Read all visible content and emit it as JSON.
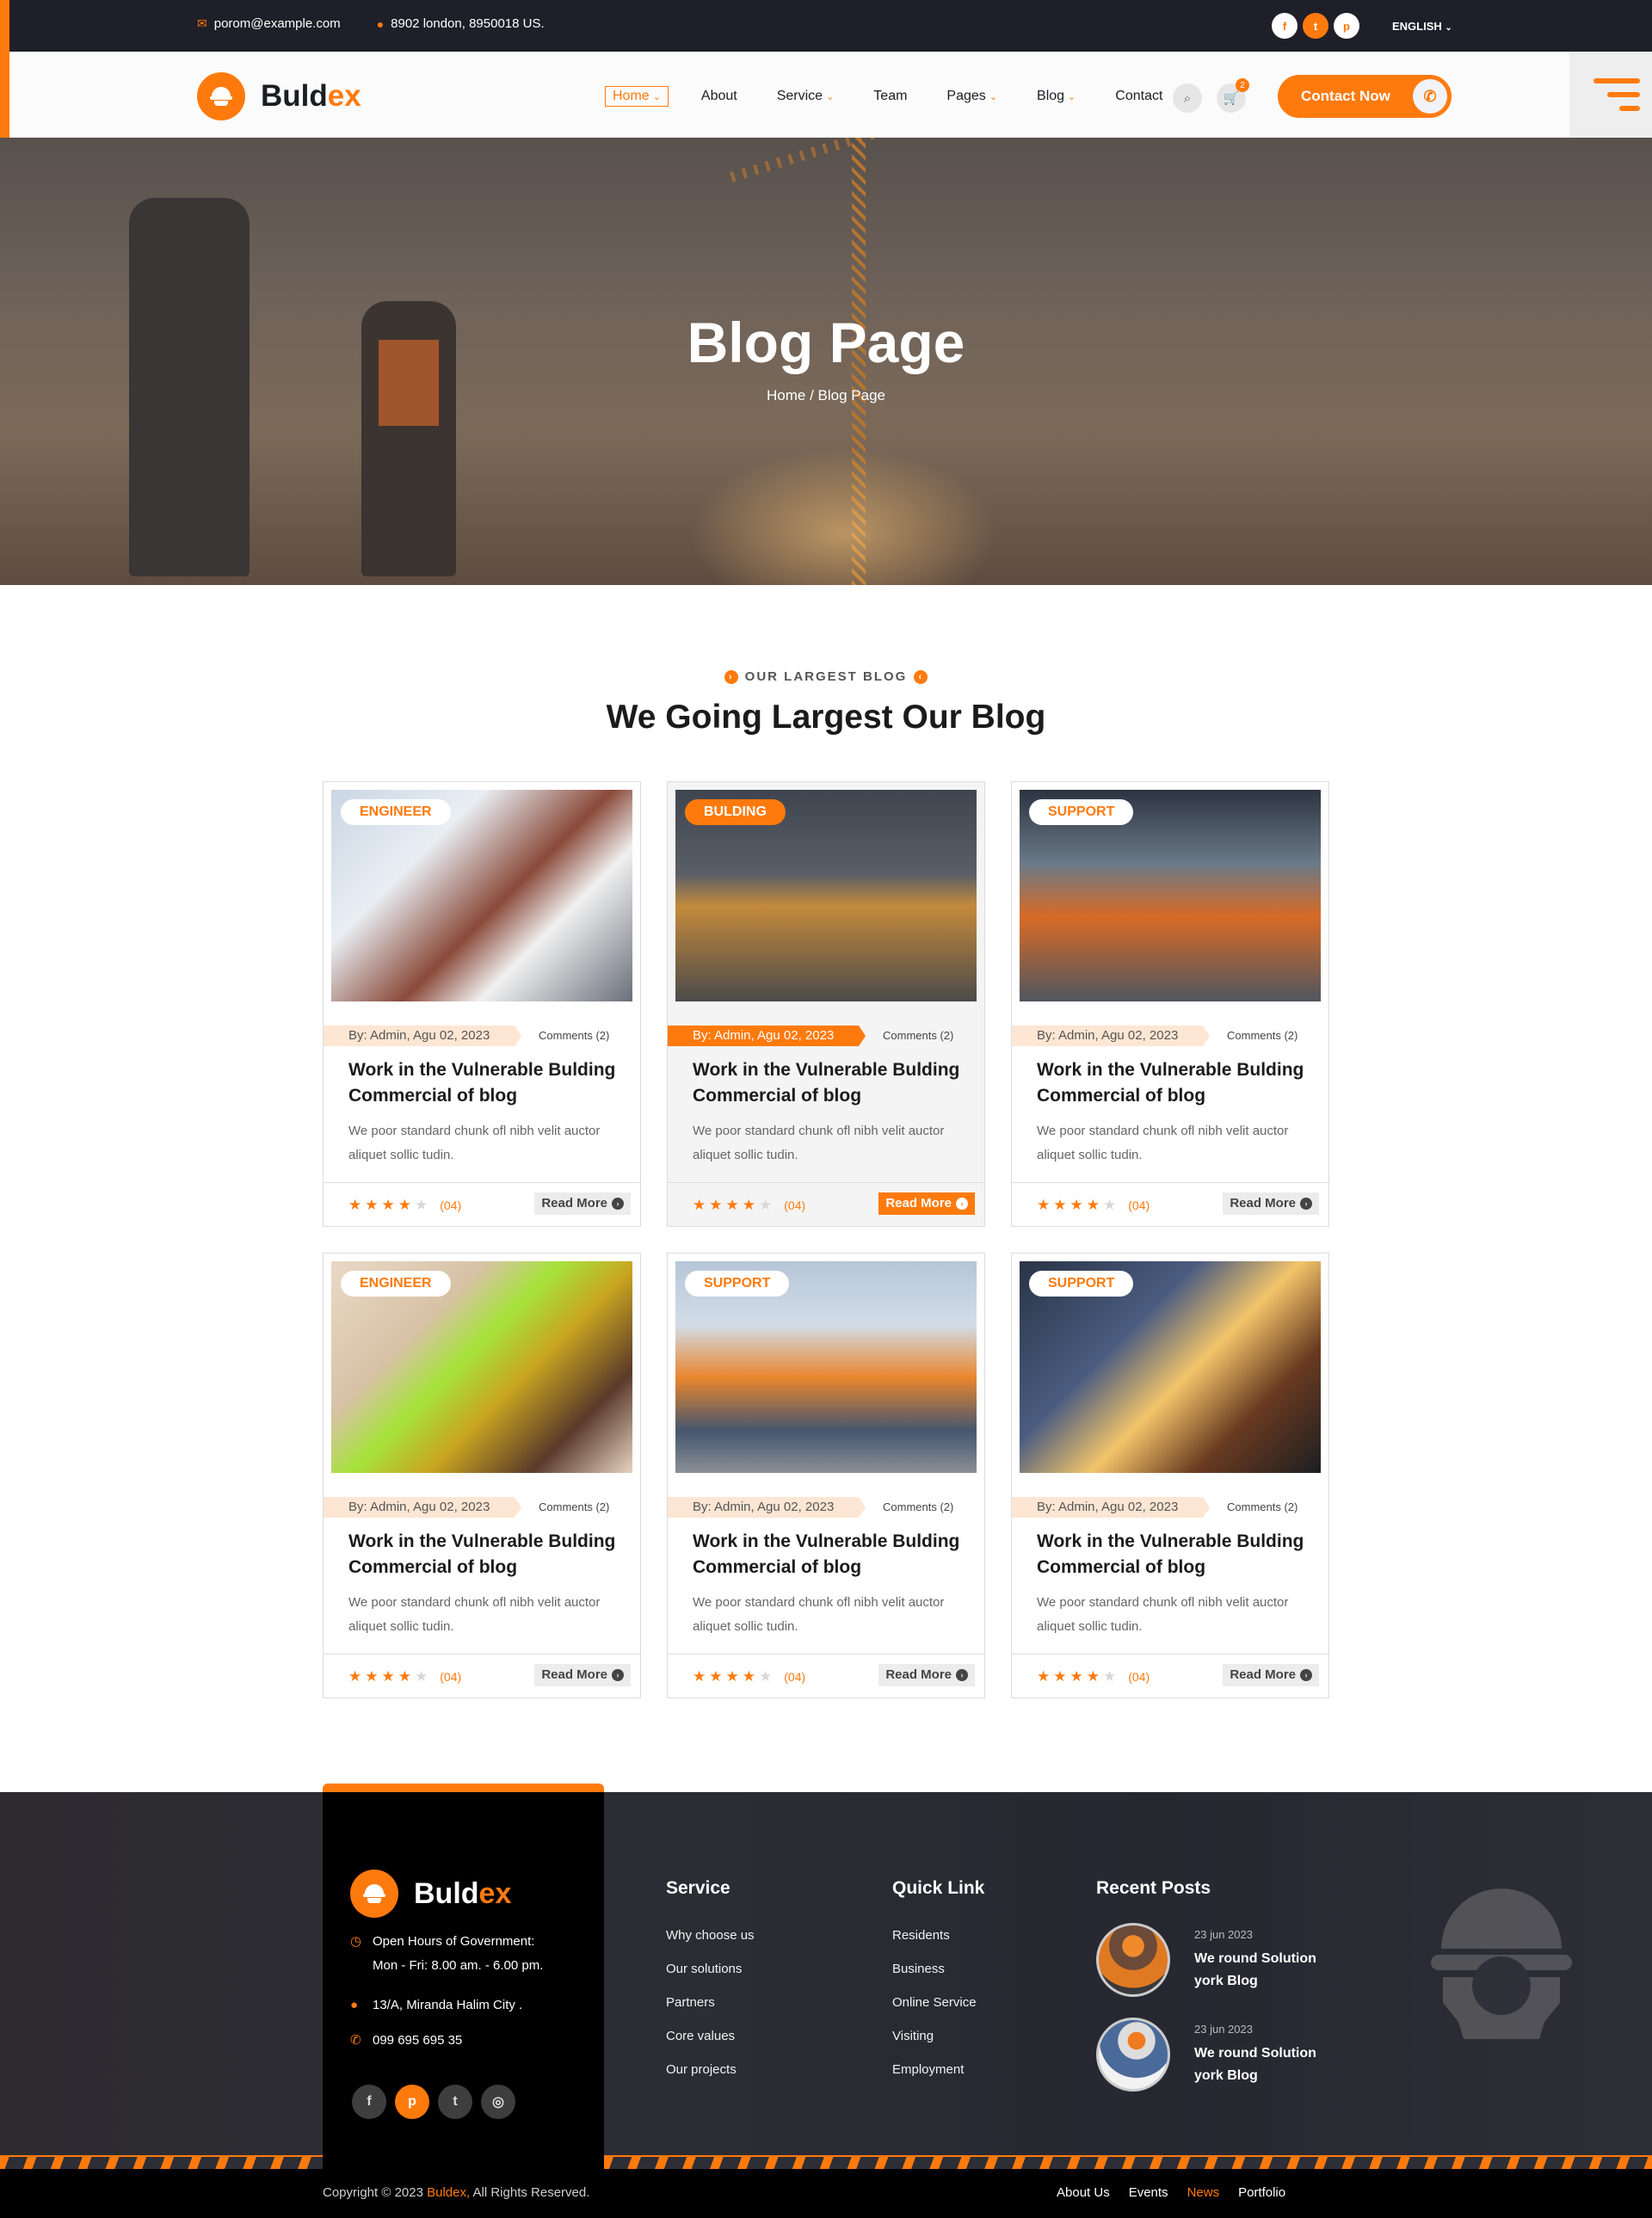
{
  "topbar": {
    "email": "porom@example.com",
    "address": "8902 london, 8950018 US.",
    "social": [
      {
        "name": "facebook",
        "glyph": "f"
      },
      {
        "name": "twitter",
        "glyph": "t"
      },
      {
        "name": "pinterest",
        "glyph": "p"
      }
    ],
    "language": "ENGLISH"
  },
  "brand": {
    "name_main": "Buld",
    "name_accent": "ex",
    "accent_color": "#ff7a0d"
  },
  "nav": {
    "items": [
      {
        "label": "Home",
        "dropdown": true,
        "active": true
      },
      {
        "label": "About",
        "dropdown": false
      },
      {
        "label": "Service",
        "dropdown": true
      },
      {
        "label": "Team",
        "dropdown": false
      },
      {
        "label": "Pages",
        "dropdown": true
      },
      {
        "label": "Blog",
        "dropdown": true
      },
      {
        "label": "Contact",
        "dropdown": false
      }
    ],
    "cart_count": "2",
    "contact_button": "Contact Now"
  },
  "hero": {
    "title": "Blog Page",
    "breadcrumb": "Home / Blog Page"
  },
  "blog": {
    "subtitle": "OUR LARGEST BLOG",
    "title": "We Going Largest Our Blog",
    "posts": [
      {
        "tag": "ENGINEER",
        "meta": "By: Admin, Agu 02, 2023",
        "comments": "Comments (2)",
        "title": "Work in the Vulnerable Bulding Commercial of blog",
        "excerpt": "We poor standard chunk ofl nibh velit auctor aliquet sollic tudin.",
        "rating": 4,
        "rating_max": 5,
        "rating_count": "(04)",
        "read_more": "Read More",
        "active": false
      },
      {
        "tag": "BULDING",
        "meta": "By: Admin, Agu 02, 2023",
        "comments": "Comments (2)",
        "title": "Work in the Vulnerable Bulding Commercial of blog",
        "excerpt": "We poor standard chunk ofl nibh velit auctor aliquet sollic tudin.",
        "rating": 4,
        "rating_max": 5,
        "rating_count": "(04)",
        "read_more": "Read More",
        "active": true
      },
      {
        "tag": "SUPPORT",
        "meta": "By: Admin, Agu 02, 2023",
        "comments": "Comments (2)",
        "title": "Work in the Vulnerable Bulding Commercial of blog",
        "excerpt": "We poor standard chunk ofl nibh velit auctor aliquet sollic tudin.",
        "rating": 4,
        "rating_max": 5,
        "rating_count": "(04)",
        "read_more": "Read More",
        "active": false
      },
      {
        "tag": "ENGINEER",
        "meta": "By: Admin, Agu 02, 2023",
        "comments": "Comments (2)",
        "title": "Work in the Vulnerable Bulding Commercial of blog",
        "excerpt": "We poor standard chunk ofl nibh velit auctor aliquet sollic tudin.",
        "rating": 4,
        "rating_max": 5,
        "rating_count": "(04)",
        "read_more": "Read More",
        "active": false
      },
      {
        "tag": "SUPPORT",
        "meta": "By: Admin, Agu 02, 2023",
        "comments": "Comments (2)",
        "title": "Work in the Vulnerable Bulding Commercial of blog",
        "excerpt": "We poor standard chunk ofl nibh velit auctor aliquet sollic tudin.",
        "rating": 4,
        "rating_max": 5,
        "rating_count": "(04)",
        "read_more": "Read More",
        "active": false
      },
      {
        "tag": "SUPPORT",
        "meta": "By: Admin, Agu 02, 2023",
        "comments": "Comments (2)",
        "title": "Work in the Vulnerable Bulding Commercial of blog",
        "excerpt": "We poor standard chunk ofl nibh velit auctor aliquet sollic tudin.",
        "rating": 4,
        "rating_max": 5,
        "rating_count": "(04)",
        "read_more": "Read More",
        "active": false
      }
    ]
  },
  "footer": {
    "hours_label": "Open Hours of Government:",
    "hours": "Mon - Fri: 8.00 am. - 6.00 pm.",
    "address": "13/A, Miranda Halim City .",
    "phone": "099 695 695 35",
    "social": [
      "facebook",
      "pinterest",
      "twitter",
      "instagram"
    ],
    "service": {
      "heading": "Service",
      "links": [
        "Why choose us",
        "Our solutions",
        "Partners",
        "Core values",
        "Our projects"
      ]
    },
    "quick": {
      "heading": "Quick Link",
      "links": [
        "Residents",
        "Business",
        "Online Service",
        "Visiting",
        "Employment"
      ]
    },
    "recent": {
      "heading": "Recent Posts",
      "posts": [
        {
          "date": "23 jun 2023",
          "title": "We round Solution york Blog"
        },
        {
          "date": "23 jun 2023",
          "title": "We round Solution york Blog"
        }
      ]
    },
    "copyright_pre": "Copyright © 2023 ",
    "copyright_brand": "Buldex,",
    "copyright_post": " All Rights Reserved.",
    "bottom_links": [
      {
        "label": "About Us",
        "active": false
      },
      {
        "label": "Events",
        "active": false
      },
      {
        "label": "News",
        "active": true
      },
      {
        "label": "Portfolio",
        "active": false
      }
    ]
  }
}
